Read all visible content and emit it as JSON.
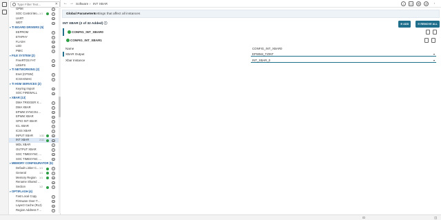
{
  "search": {
    "placeholder": "Type Filter Text..."
  },
  "tree": [
    {
      "type": "item",
      "label": "GPMI",
      "count": "",
      "ok": false
    },
    {
      "type": "item",
      "label": "SOC Control Mo...",
      "count": "1/1",
      "ok": true
    },
    {
      "type": "item",
      "label": "UART",
      "count": "",
      "ok": false
    },
    {
      "type": "item",
      "label": "WDT",
      "count": "",
      "ok": false
    },
    {
      "type": "cat",
      "label": "TI BOARD DRIVERS (5)"
    },
    {
      "type": "item",
      "label": "EEPROM",
      "count": "",
      "ok": false
    },
    {
      "type": "item",
      "label": "ETHPHY",
      "count": "",
      "ok": false
    },
    {
      "type": "item",
      "label": "FLASH",
      "count": "",
      "ok": false
    },
    {
      "type": "item",
      "label": "LED",
      "count": "",
      "ok": false
    },
    {
      "type": "item",
      "label": "PMIC",
      "count": "",
      "ok": false
    },
    {
      "type": "cat",
      "label": "FILE SYSTEM (2)"
    },
    {
      "type": "item",
      "label": "FreeRTOS FAT",
      "count": "",
      "ok": false
    },
    {
      "type": "item",
      "label": "LittleFS",
      "count": "",
      "ok": false
    },
    {
      "type": "cat",
      "label": "TI NETWORKING (2)"
    },
    {
      "type": "item",
      "label": "Enet (CPSW)",
      "count": "",
      "ok": false
    },
    {
      "type": "item",
      "label": "ICSS-EMAC",
      "count": "",
      "ok": false
    },
    {
      "type": "cat",
      "label": "TI HSM SERVICES (2)"
    },
    {
      "type": "item",
      "label": "Keyring Import",
      "count": "",
      "ok": false
    },
    {
      "type": "item",
      "label": "SOC FIREWALL",
      "count": "",
      "ok": false
    },
    {
      "type": "cat",
      "label": "XBAR (13)"
    },
    {
      "type": "item",
      "label": "DMA TRIGGER XBAR",
      "count": "",
      "ok": false
    },
    {
      "type": "item",
      "label": "DMA XBAR",
      "count": "",
      "ok": false
    },
    {
      "type": "item",
      "label": "EPWM SYNCOUT XBAR",
      "count": "",
      "ok": false
    },
    {
      "type": "item",
      "label": "EPWM XBAR",
      "count": "",
      "ok": false
    },
    {
      "type": "item",
      "label": "GPIO INT XBAR",
      "count": "",
      "ok": false
    },
    {
      "type": "item",
      "label": "ICL XBAR",
      "count": "",
      "ok": false
    },
    {
      "type": "item",
      "label": "ICSS XBAR",
      "count": "",
      "ok": false
    },
    {
      "type": "item",
      "label": "INPUT XBAR",
      "count": "1/32",
      "ok": true
    },
    {
      "type": "item",
      "label": "INT XBAR",
      "count": "2/32",
      "ok": true,
      "selected": true
    },
    {
      "type": "item",
      "label": "MDL XBAR",
      "count": "",
      "ok": false
    },
    {
      "type": "item",
      "label": "OUTPUT XBAR",
      "count": "",
      "ok": false
    },
    {
      "type": "item",
      "label": "SOC TIMESYNC XBAR 0",
      "count": "",
      "ok": false
    },
    {
      "type": "item",
      "label": "SOC TIMESYNC XBAR 1",
      "count": "",
      "ok": false
    },
    {
      "type": "cat",
      "label": "MEMORY CONFIGURATOR (5)"
    },
    {
      "type": "item",
      "label": "Default Linker C...",
      "count": "1/1",
      "ok": true
    },
    {
      "type": "item",
      "label": "General",
      "count": "1/1",
      "ok": true
    },
    {
      "type": "item",
      "label": "Memory Region",
      "count": "1/1",
      "ok": true
    },
    {
      "type": "item",
      "label": "Rename Shared Regions",
      "count": "",
      "ok": false
    },
    {
      "type": "item",
      "label": "Section",
      "count": "1/2",
      "ok": true
    },
    {
      "type": "cat",
      "label": "OPTIFLASH (4)"
    },
    {
      "type": "item",
      "label": "Fast Local Copy",
      "count": "",
      "ok": false
    },
    {
      "type": "item",
      "label": "Firmware Over-The-Air (F...",
      "count": "",
      "ok": false
    },
    {
      "type": "item",
      "label": "Layer2 Cache (RL2)",
      "count": "",
      "ok": false
    },
    {
      "type": "item",
      "label": "Region Address Translati...",
      "count": "",
      "ok": false
    }
  ],
  "breadcrumb": {
    "part1": "Software",
    "sep": "›",
    "part2": "INT XBAR"
  },
  "global": {
    "title": "Global Parameters",
    "desc": "Settings that affect all instances"
  },
  "section": {
    "title": "INT XBAR (2 of 32 Added)",
    "info": "ⓘ",
    "add": "⊕ ADD",
    "remove_all": "⊖ REMOVE ALL"
  },
  "instances": [
    {
      "name": "CONFIG_INT_XBAR0"
    },
    {
      "name": "CONFIG_INT_XBAR1"
    }
  ],
  "fields": {
    "name_label": "Name",
    "name_value": "CONFIG_INT_XBAR0",
    "output_label": "XBAR Output",
    "output_value": "EPWM4_TZINT",
    "instance_label": "Xbar Instance",
    "instance_value": "INT_XBAR_0"
  },
  "colors": {
    "accent": "#1f6e8c",
    "ok": "#2e9e45",
    "selection": "#dde8f6"
  }
}
